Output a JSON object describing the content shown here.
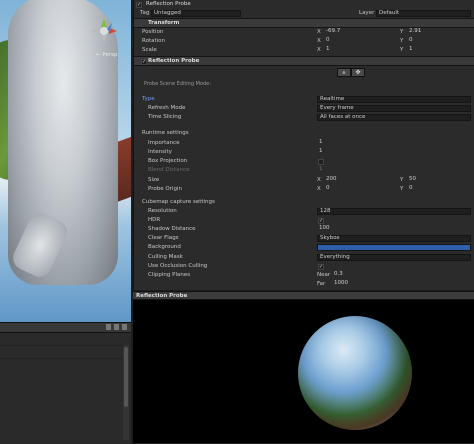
{
  "inspector": {
    "object_name": "Reflection Probe",
    "tag_label": "Tag",
    "tag_value": "Untagged",
    "layer_label": "Layer",
    "layer_value": "Default",
    "transform": {
      "title": "Transform",
      "position_label": "Position",
      "rotation_label": "Rotation",
      "scale_label": "Scale",
      "position": {
        "x": "-69.7",
        "y": "2.91"
      },
      "rotation": {
        "x": "0",
        "y": "0"
      },
      "scale": {
        "x": "1",
        "y": "1"
      }
    },
    "probe": {
      "title": "Reflection Probe",
      "edit_mode_label": "Probe Scene Editing Mode:",
      "type_label": "Type",
      "type_value": "Realtime",
      "refresh_mode_label": "Refresh Mode",
      "refresh_mode_value": "Every frame",
      "time_slicing_label": "Time Slicing",
      "time_slicing_value": "All faces at once",
      "runtime_settings_label": "Runtime settings",
      "importance_label": "Importance",
      "importance_value": "1",
      "intensity_label": "Intensity",
      "intensity_value": "1",
      "box_projection_label": "Box Projection",
      "blend_distance_label": "Blend Distance",
      "blend_distance_value": "1",
      "size_label": "Size",
      "size": {
        "x": "200",
        "y": "50"
      },
      "probe_origin_label": "Probe Origin",
      "probe_origin": {
        "x": "0",
        "y": "0"
      },
      "cubemap_settings_label": "Cubemap capture settings",
      "resolution_label": "Resolution",
      "resolution_value": "128",
      "hdr_label": "HDR",
      "shadow_distance_label": "Shadow Distance",
      "shadow_distance_value": "100",
      "clear_flags_label": "Clear Flags",
      "clear_flags_value": "Skybox",
      "background_label": "Background",
      "background_color": "#2f5fa8",
      "culling_mask_label": "Culling Mask",
      "culling_mask_value": "Everything",
      "occlusion_label": "Use Occlusion Culling",
      "clipping_label": "Clipping Planes",
      "near_label": "Near",
      "near_value": "0.3",
      "far_label": "Far",
      "far_value": "1000"
    }
  },
  "scene_view": {
    "persp_label": "← Persp"
  },
  "preview": {
    "title": "Reflection Probe"
  },
  "axis": {
    "x": "X",
    "y": "Y"
  },
  "check": "✓"
}
